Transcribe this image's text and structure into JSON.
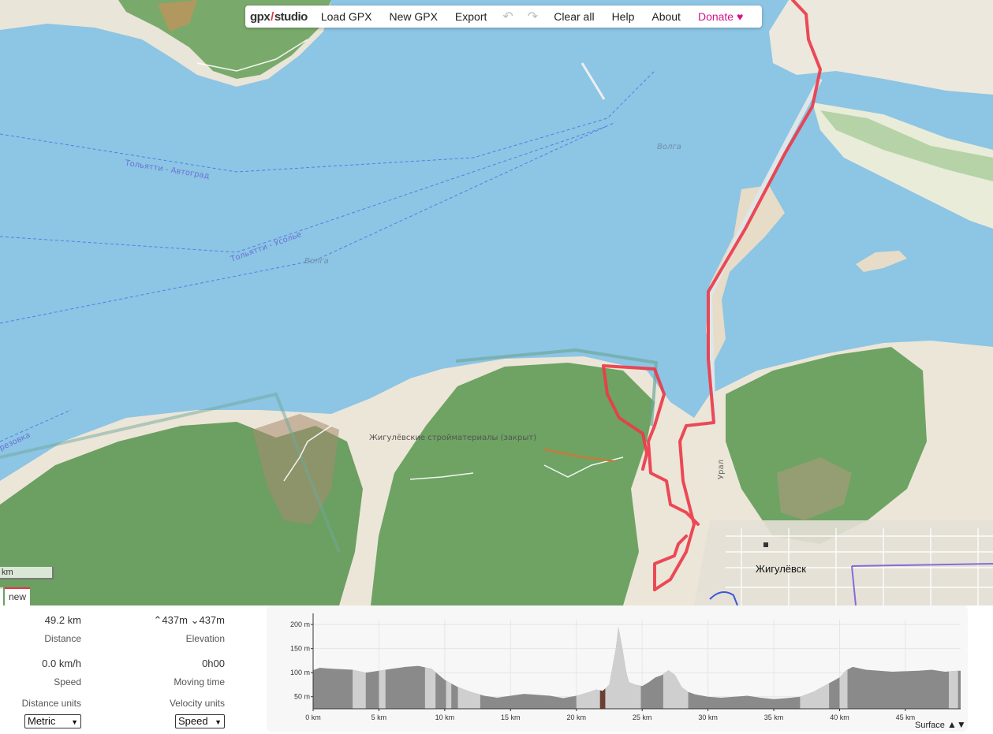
{
  "toolbar": {
    "logo_left": "gpx",
    "logo_right": "studio",
    "load": "Load GPX",
    "new": "New GPX",
    "export": "Export",
    "undo_icon": "undo-icon",
    "redo_icon": "redo-icon",
    "clear": "Clear all",
    "help": "Help",
    "about": "About",
    "donate": "Donate",
    "heart": "♥"
  },
  "map": {
    "labels": {
      "ferry1": "Тольятти - Автоград",
      "ferry2": "Тольятти - Усолье",
      "river1": "Волга",
      "river2": "Волга",
      "area": "Жигулёвские стройматериалы (закрыт)",
      "city": "Жигулёвск",
      "road": "Урал",
      "ferry3": "резовка"
    },
    "scale": "km",
    "tab": "new",
    "colors": {
      "water": "#8dc5e4",
      "forest": "#6da262",
      "land": "#efe9de",
      "route": "#ec3b4a"
    }
  },
  "stats": {
    "distance_value": "49.2 km",
    "distance_label": "Distance",
    "elev_up": "437m",
    "elev_down": "437m",
    "elevation_label": "Elevation",
    "speed_value": "0.0 km/h",
    "speed_label": "Speed",
    "moving_value": "0h00",
    "moving_label": "Moving time",
    "distance_units_label": "Distance units",
    "velocity_units_label": "Velocity units",
    "distance_units_value": "Metric",
    "velocity_units_value": "Speed"
  },
  "chart_data": {
    "type": "area",
    "xlabel": "",
    "ylabel": "",
    "xlim": [
      0,
      49.2
    ],
    "ylim": [
      25,
      210
    ],
    "x_ticks": [
      "0 km",
      "5 km",
      "10 km",
      "15 km",
      "20 km",
      "25 km",
      "30 km",
      "35 km",
      "40 km",
      "45 km"
    ],
    "x_tick_values": [
      0,
      5,
      10,
      15,
      20,
      25,
      30,
      35,
      40,
      45
    ],
    "y_ticks": [
      "50 m",
      "100 m",
      "150 m",
      "200 m"
    ],
    "y_tick_values": [
      50,
      100,
      150,
      200
    ],
    "x": [
      0,
      0.5,
      1.5,
      3,
      4,
      5,
      6,
      7,
      8,
      9,
      10,
      11,
      12,
      13,
      14,
      15,
      16,
      17,
      18,
      19,
      20,
      20.5,
      21,
      21.5,
      22,
      22.5,
      23,
      23.2,
      23.5,
      23.8,
      24,
      24.5,
      25,
      25.5,
      26,
      26.5,
      27,
      27.5,
      28,
      28.5,
      29,
      30,
      31,
      32,
      33,
      34,
      35,
      36,
      37,
      38,
      39,
      40,
      40.5,
      41,
      42,
      43,
      44,
      45,
      46,
      47,
      48,
      49,
      49.2
    ],
    "y": [
      105,
      110,
      108,
      106,
      100,
      104,
      108,
      112,
      114,
      108,
      85,
      70,
      60,
      52,
      48,
      52,
      56,
      54,
      52,
      47,
      52,
      56,
      60,
      65,
      62,
      75,
      150,
      195,
      150,
      100,
      80,
      75,
      72,
      80,
      90,
      95,
      105,
      95,
      70,
      60,
      55,
      50,
      48,
      50,
      52,
      48,
      45,
      47,
      50,
      60,
      75,
      90,
      105,
      112,
      106,
      104,
      102,
      103,
      104,
      106,
      102,
      104,
      104
    ],
    "legend": "Surface",
    "surface_bands": [
      {
        "from": 0,
        "to": 1,
        "shade": "#8a8a8a"
      },
      {
        "from": 3,
        "to": 4,
        "shade": "#cfcfcf"
      },
      {
        "from": 5,
        "to": 5.5,
        "shade": "#cfcfcf"
      },
      {
        "from": 8.5,
        "to": 9.3,
        "shade": "#cfcfcf"
      },
      {
        "from": 10.1,
        "to": 10.5,
        "shade": "#cfcfcf"
      },
      {
        "from": 11,
        "to": 12.7,
        "shade": "#cfcfcf"
      },
      {
        "from": 20,
        "to": 21.8,
        "shade": "#cfcfcf"
      },
      {
        "from": 21.8,
        "to": 22.2,
        "shade": "#6d3f32"
      },
      {
        "from": 22.2,
        "to": 24.9,
        "shade": "#cfcfcf"
      },
      {
        "from": 26.6,
        "to": 28.5,
        "shade": "#cfcfcf"
      },
      {
        "from": 37,
        "to": 39.2,
        "shade": "#cfcfcf"
      },
      {
        "from": 40,
        "to": 40.6,
        "shade": "#cfcfcf"
      },
      {
        "from": 48.3,
        "to": 49,
        "shade": "#cfcfcf"
      }
    ]
  }
}
